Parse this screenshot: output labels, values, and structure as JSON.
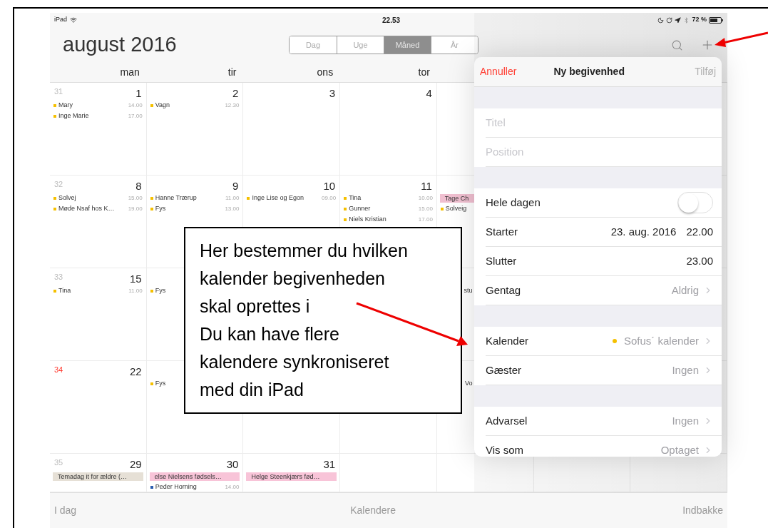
{
  "status_bar": {
    "device": "iPad",
    "time": "22.53",
    "battery": "72 %"
  },
  "nav_bar": {
    "title": "august 2016",
    "segments": [
      {
        "label": "Dag",
        "selected": false
      },
      {
        "label": "Uge",
        "selected": false
      },
      {
        "label": "Måned",
        "selected": true
      },
      {
        "label": "År",
        "selected": false
      }
    ]
  },
  "weekdays": [
    "man",
    "tir",
    "ons",
    "tor"
  ],
  "weeks": [
    {
      "number": "31",
      "current": false,
      "days": [
        {
          "date": "1",
          "events": [
            {
              "kind": "timed",
              "name": "Mary",
              "time": "14.00",
              "color": "#f5c000"
            },
            {
              "kind": "timed",
              "name": "Inge Marie",
              "time": "17.00",
              "color": "#f5c000"
            }
          ]
        },
        {
          "date": "2",
          "events": [
            {
              "kind": "timed",
              "name": "Vagn",
              "time": "12.30",
              "color": "#f5c000"
            }
          ]
        },
        {
          "date": "3"
        },
        {
          "date": "4"
        }
      ]
    },
    {
      "number": "32",
      "current": false,
      "days": [
        {
          "date": "8",
          "events": [
            {
              "kind": "timed",
              "name": "Solvej",
              "time": "15.00",
              "color": "#f5c000"
            },
            {
              "kind": "timed",
              "name": "Møde Nsaf hos K…",
              "time": "19.00",
              "color": "#f5c000"
            }
          ]
        },
        {
          "date": "9",
          "events": [
            {
              "kind": "timed",
              "name": "Hanne Trærup",
              "time": "11.00",
              "color": "#f5c000"
            },
            {
              "kind": "timed",
              "name": "Fys",
              "time": "13.00",
              "color": "#f5c000"
            }
          ]
        },
        {
          "date": "10",
          "events": [
            {
              "kind": "timed",
              "name": "Inge Lise og Egon",
              "time": "09.00",
              "color": "#f5c000"
            }
          ]
        },
        {
          "date": "11",
          "events": [
            {
              "kind": "timed",
              "name": "Tina",
              "time": "10.00",
              "color": "#f5c000"
            },
            {
              "kind": "timed",
              "name": "Gunner",
              "time": "15.00",
              "color": "#f5c000"
            },
            {
              "kind": "timed",
              "name": "Niels Kristian",
              "time": "17.00",
              "color": "#f5c000"
            }
          ]
        }
      ],
      "column_5": [
        {
          "kind": "allday",
          "name": "Tage Ch",
          "color": "#f0bfd0"
        },
        {
          "kind": "timed",
          "name": "Solveig",
          "color": "#f5c000"
        }
      ]
    },
    {
      "number": "33",
      "current": false,
      "days": [
        {
          "date": "15",
          "events": [
            {
              "kind": "timed",
              "name": "Tina",
              "time": "11.00",
              "color": "#f5c000"
            }
          ]
        },
        {
          "events": [
            {
              "kind": "timed",
              "name": "Fys",
              "color": "#f5c000"
            }
          ]
        }
      ],
      "column_5": [
        {
          "kind": "fragment",
          "name": "stu"
        }
      ]
    },
    {
      "number": "34",
      "current": true,
      "days": [
        {
          "date": "22"
        },
        {
          "events": [
            {
              "kind": "timed",
              "name": "Fys",
              "color": "#f5c000"
            }
          ]
        }
      ],
      "column_5": [
        {
          "kind": "fragment",
          "name": "Vo"
        }
      ]
    },
    {
      "number": "35",
      "current": false,
      "days": [
        {
          "date": "29",
          "events": [
            {
              "kind": "allday",
              "name": "Temadag it for ældre (…",
              "color": "#e6e0d6"
            }
          ]
        },
        {
          "date": "30",
          "events": [
            {
              "kind": "allday",
              "name": "else Nielsens fødsels…",
              "color": "#f8c4d8"
            },
            {
              "kind": "timed",
              "name": "Peder Horning",
              "time": "14.00",
              "color": "#2a5db0"
            }
          ]
        },
        {
          "date": "31",
          "events": [
            {
              "kind": "allday",
              "name": "Helge Steenkjærs fød…",
              "color": "#f8c4d8"
            }
          ]
        }
      ]
    }
  ],
  "new_event": {
    "cancel": "Annuller",
    "title": "Ny begivenhed",
    "add": {
      "label": "Tilføj",
      "disabled": true
    },
    "sections": [
      [
        {
          "kind": "field",
          "placeholder": "Titel"
        },
        {
          "kind": "field",
          "placeholder": "Position"
        }
      ],
      [
        {
          "kind": "toggle",
          "label": "Hele dagen",
          "on": false
        },
        {
          "kind": "datetime",
          "label": "Starter",
          "date": "23. aug. 2016",
          "time": "22.00"
        },
        {
          "kind": "datetime",
          "label": "Slutter",
          "time": "23.00"
        },
        {
          "kind": "link",
          "label": "Gentag",
          "value": "Aldrig"
        }
      ],
      [
        {
          "kind": "link",
          "label": "Kalender",
          "value": "Sofus´ kalender",
          "color": "#f5c000"
        },
        {
          "kind": "link",
          "label": "Gæster",
          "value": "Ingen"
        }
      ],
      [
        {
          "kind": "link",
          "label": "Advarsel",
          "value": "Ingen"
        },
        {
          "kind": "link",
          "label": "Vis som",
          "value": "Optaget"
        }
      ]
    ]
  },
  "toolbar": {
    "today": "I dag",
    "calendars": "Kalendere",
    "inbox": "Indbakke"
  },
  "annotation": {
    "paragraphs": [
      "Her bestemmer du hvilken kalender begivenheden skal oprettes i",
      "Du kan have flere kalendere synkroniseret med din iPad"
    ]
  }
}
